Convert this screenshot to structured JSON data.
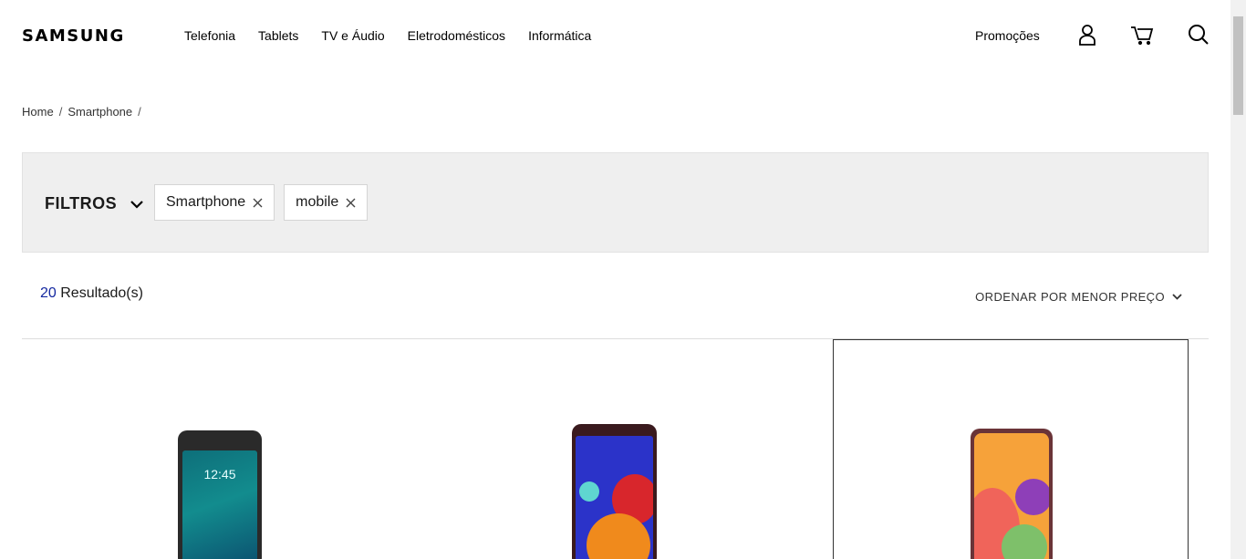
{
  "header": {
    "logo": "SAMSUNG",
    "nav": [
      "Telefonia",
      "Tablets",
      "TV e Áudio",
      "Eletrodomésticos",
      "Informática"
    ],
    "promo": "Promoções",
    "icons": [
      "user-icon",
      "cart-icon",
      "search-icon"
    ]
  },
  "breadcrumb": {
    "items": [
      "Home",
      "Smartphone"
    ],
    "separator": "/"
  },
  "filters": {
    "title": "FILTROS",
    "chips": [
      "Smartphone",
      "mobile"
    ]
  },
  "results": {
    "count": "20",
    "label": " Resultado(s)"
  },
  "sort": {
    "label": "ORDENAR POR MENOR PREÇO"
  },
  "products": [
    {
      "name": "phone-1",
      "screen_time": "12:45",
      "selected": false
    },
    {
      "name": "phone-2",
      "selected": false
    },
    {
      "name": "phone-3",
      "selected": true
    }
  ],
  "colors": {
    "accent": "#1428a0",
    "filter_bg": "#efefef"
  }
}
